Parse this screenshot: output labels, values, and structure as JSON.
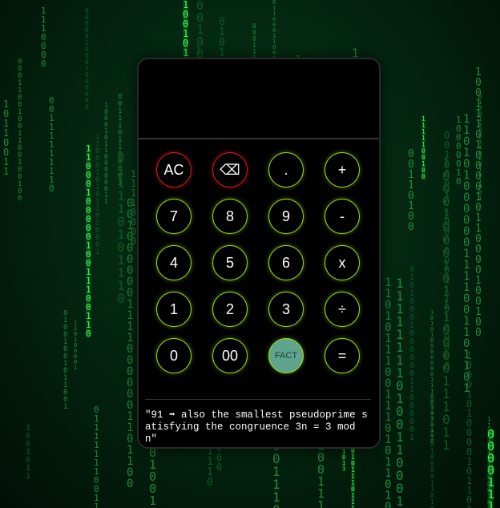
{
  "display": {
    "value": ""
  },
  "keys": {
    "ac": "AC",
    "backspace": "⌫",
    "dot": ".",
    "plus": "+",
    "seven": "7",
    "eight": "8",
    "nine": "9",
    "minus": "-",
    "four": "4",
    "five": "5",
    "six": "6",
    "multiply": "x",
    "one": "1",
    "two": "2",
    "three": "3",
    "divide": "÷",
    "zero": "0",
    "double_zero": "00",
    "fact": "FACT",
    "equals": "="
  },
  "fact": {
    "text": "\"91 ➡ also the smallest pseudoprime satisfying the congruence 3n = 3 mod n\""
  },
  "colors": {
    "accent_green": "#9be11a",
    "accent_red": "#e01a1a",
    "fact_button": "#5fa58e",
    "matrix_green": "#3cff5c"
  }
}
